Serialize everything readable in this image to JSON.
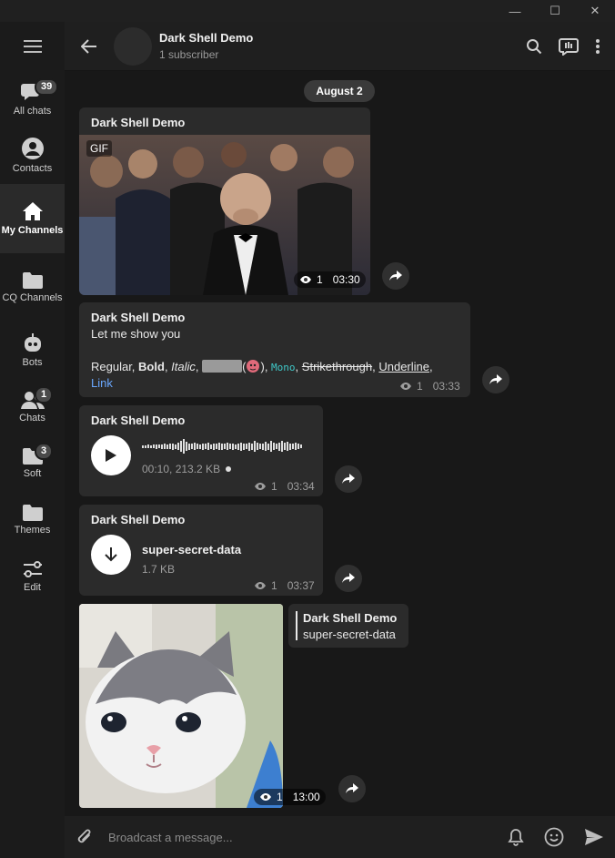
{
  "window": {
    "minimize": "—",
    "maximize": "☐",
    "close": "✕"
  },
  "sidebar": {
    "items": [
      {
        "label": "All chats",
        "badge": "39"
      },
      {
        "label": "Contacts",
        "badge": ""
      },
      {
        "label": "My Channels",
        "badge": ""
      },
      {
        "label": "CQ Channels",
        "badge": ""
      },
      {
        "label": "Bots",
        "badge": ""
      },
      {
        "label": "Chats",
        "badge": "1"
      },
      {
        "label": "Soft",
        "badge": "3"
      },
      {
        "label": "Themes",
        "badge": ""
      },
      {
        "label": "Edit",
        "badge": ""
      }
    ]
  },
  "header": {
    "title": "Dark Shell Demo",
    "subtitle": "1 subscriber"
  },
  "date_separator": "August 2",
  "messages": [
    {
      "sender": "Dark Shell Demo",
      "gif_label": "GIF",
      "views": "1",
      "time": "03:30"
    },
    {
      "sender": "Dark Shell Demo",
      "line1": "Let me show you",
      "fmt": {
        "regular": "Regular, ",
        "bold": "Bold",
        "sep1": ", ",
        "italic": "Italic",
        "sep2": ", ",
        "paren_open": "(",
        "paren_close": "), ",
        "mono": "Mono",
        "sep3": ", ",
        "strike": "Strikethrough",
        "sep4": ", ",
        "underline": "Underline",
        "sep5": ",",
        "link": "Link"
      },
      "views": "1",
      "time": "03:33"
    },
    {
      "sender": "Dark Shell Demo",
      "audio_info": "00:10, 213.2 KB",
      "views": "1",
      "time": "03:34"
    },
    {
      "sender": "Dark Shell Demo",
      "file_name": "super-secret-data",
      "file_size": "1.7 KB",
      "views": "1",
      "time": "03:37"
    },
    {
      "reply_sender": "Dark Shell Demo",
      "reply_text": "super-secret-data",
      "views": "1",
      "time": "13:00"
    }
  ],
  "composer": {
    "placeholder": "Broadcast a message..."
  },
  "colors": {
    "bubble": "#2b2b2b",
    "link": "#6aa8ff",
    "mono": "#3fc8c8",
    "background": "#181818"
  }
}
